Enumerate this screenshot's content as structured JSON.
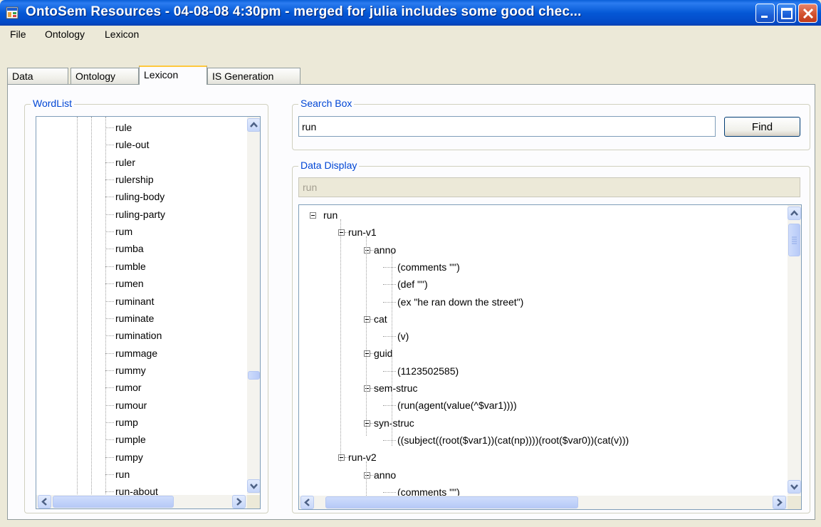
{
  "window": {
    "title": "OntoSem Resources - 04-08-08 4:30pm - merged for julia includes some good chec..."
  },
  "menu": [
    "File",
    "Ontology",
    "Lexicon"
  ],
  "tabs": [
    "Data",
    "Ontology",
    "Lexicon",
    "IS Generation"
  ],
  "active_tab": "Lexicon",
  "wordlist": {
    "title": "WordList",
    "items": [
      "rule",
      "rule-out",
      "ruler",
      "rulership",
      "ruling-body",
      "ruling-party",
      "rum",
      "rumba",
      "rumble",
      "rumen",
      "ruminant",
      "ruminate",
      "rumination",
      "rummage",
      "rummy",
      "rumor",
      "rumour",
      "rump",
      "rumple",
      "rumpy",
      "run",
      "run-about"
    ]
  },
  "search": {
    "title": "Search Box",
    "value": "run",
    "find_label": "Find"
  },
  "display": {
    "title": "Data Display",
    "selected": "run",
    "tree": [
      {
        "text": "run",
        "level": 0,
        "expander": true
      },
      {
        "text": "run-v1",
        "level": 1,
        "expander": true
      },
      {
        "text": "anno",
        "level": 2,
        "expander": true
      },
      {
        "text": "(comments \"\")",
        "level": 3,
        "expander": false
      },
      {
        "text": "(def \"\")",
        "level": 3,
        "expander": false
      },
      {
        "text": "(ex \"he ran down the street\")",
        "level": 3,
        "expander": false
      },
      {
        "text": "cat",
        "level": 2,
        "expander": true
      },
      {
        "text": "(v)",
        "level": 3,
        "expander": false
      },
      {
        "text": "guid",
        "level": 2,
        "expander": true
      },
      {
        "text": "(1123502585)",
        "level": 3,
        "expander": false
      },
      {
        "text": "sem-struc",
        "level": 2,
        "expander": true
      },
      {
        "text": "(run(agent(value(^$var1))))",
        "level": 3,
        "expander": false
      },
      {
        "text": "syn-struc",
        "level": 2,
        "expander": true
      },
      {
        "text": "((subject((root($var1))(cat(np))))(root($var0))(cat(v)))",
        "level": 3,
        "expander": false
      },
      {
        "text": "run-v2",
        "level": 1,
        "expander": true
      },
      {
        "text": "anno",
        "level": 2,
        "expander": true
      },
      {
        "text": "(comments \"\")",
        "level": 3,
        "expander": false
      }
    ]
  },
  "colors": {
    "titlebar": "#0458d6",
    "group_title": "#0046d5",
    "close_button": "#d3532f"
  }
}
